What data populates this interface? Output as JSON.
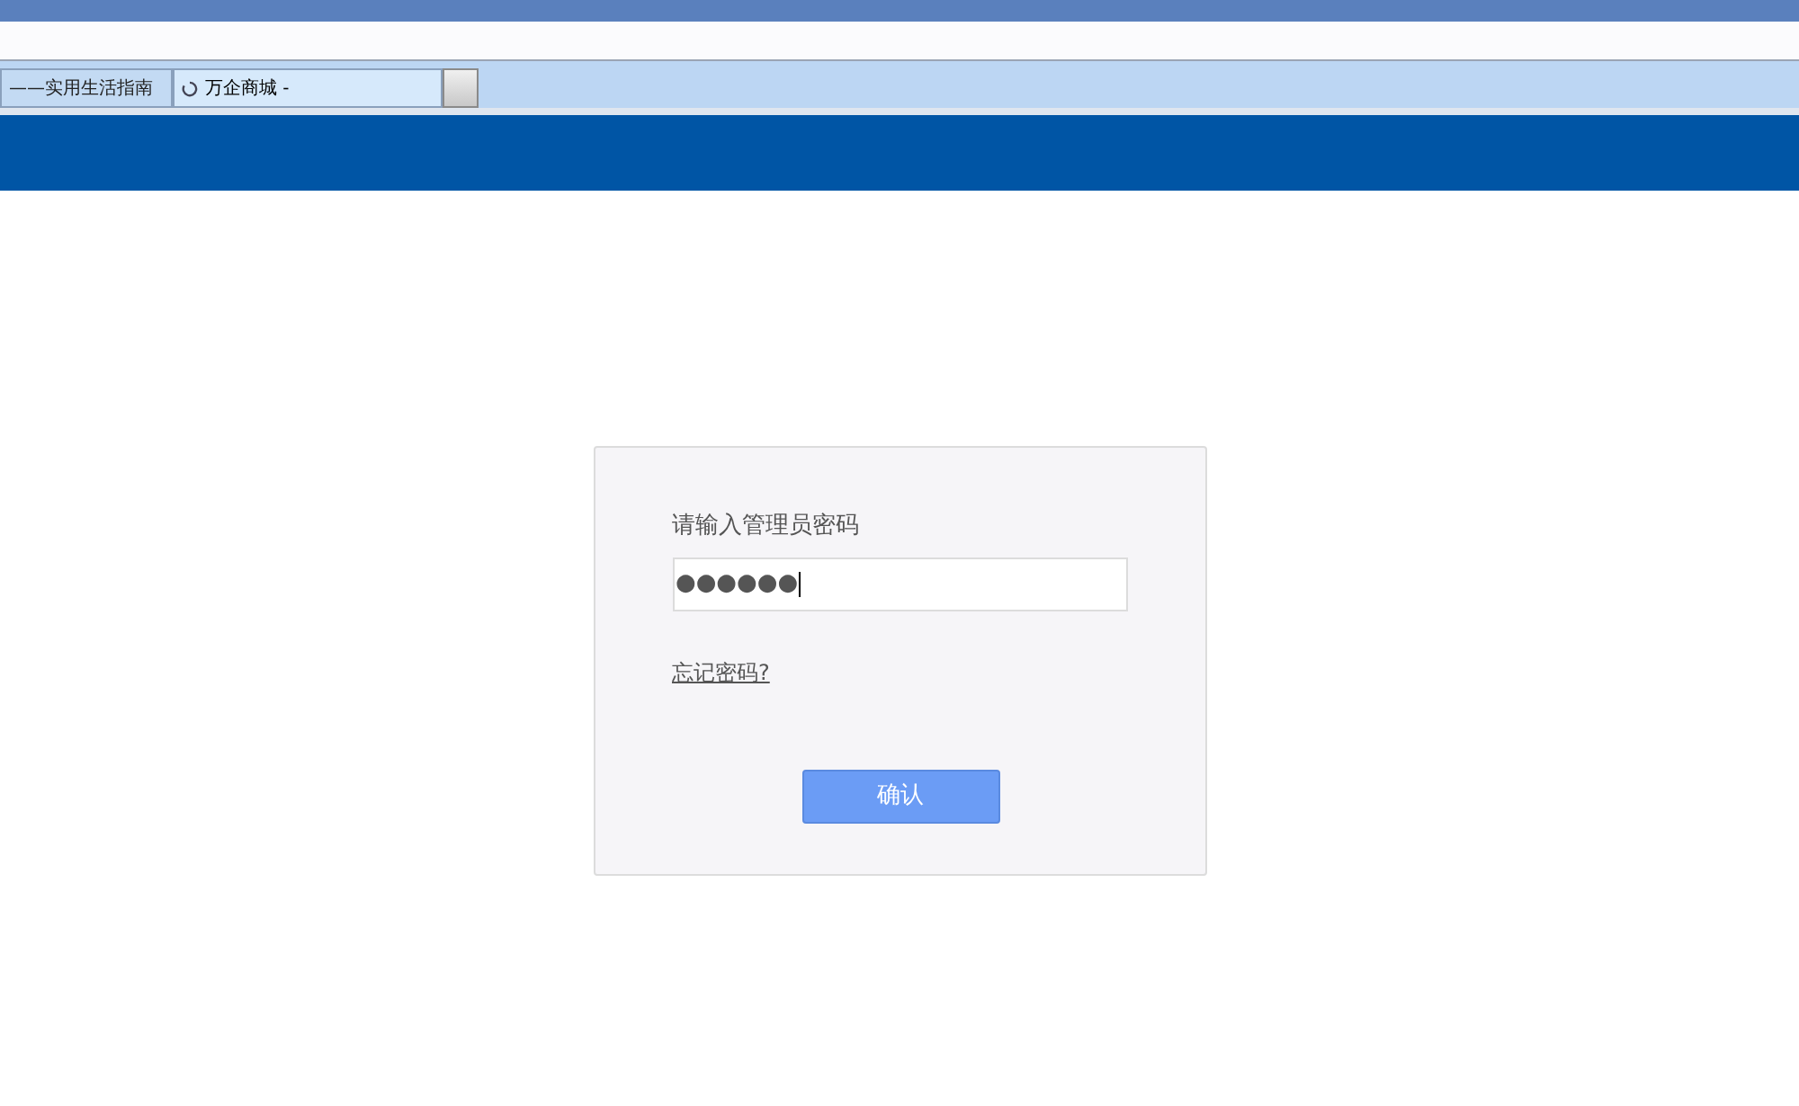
{
  "browser_tabs": [
    {
      "label": "——实用生活指南",
      "selected": false,
      "loading": false
    },
    {
      "label": "万企商城 -",
      "selected": true,
      "loading": true
    }
  ],
  "login": {
    "label": "请输入管理员密码",
    "password_value": "●●●●●●",
    "forgot_link": "忘记密码?",
    "confirm_button": "确认"
  }
}
